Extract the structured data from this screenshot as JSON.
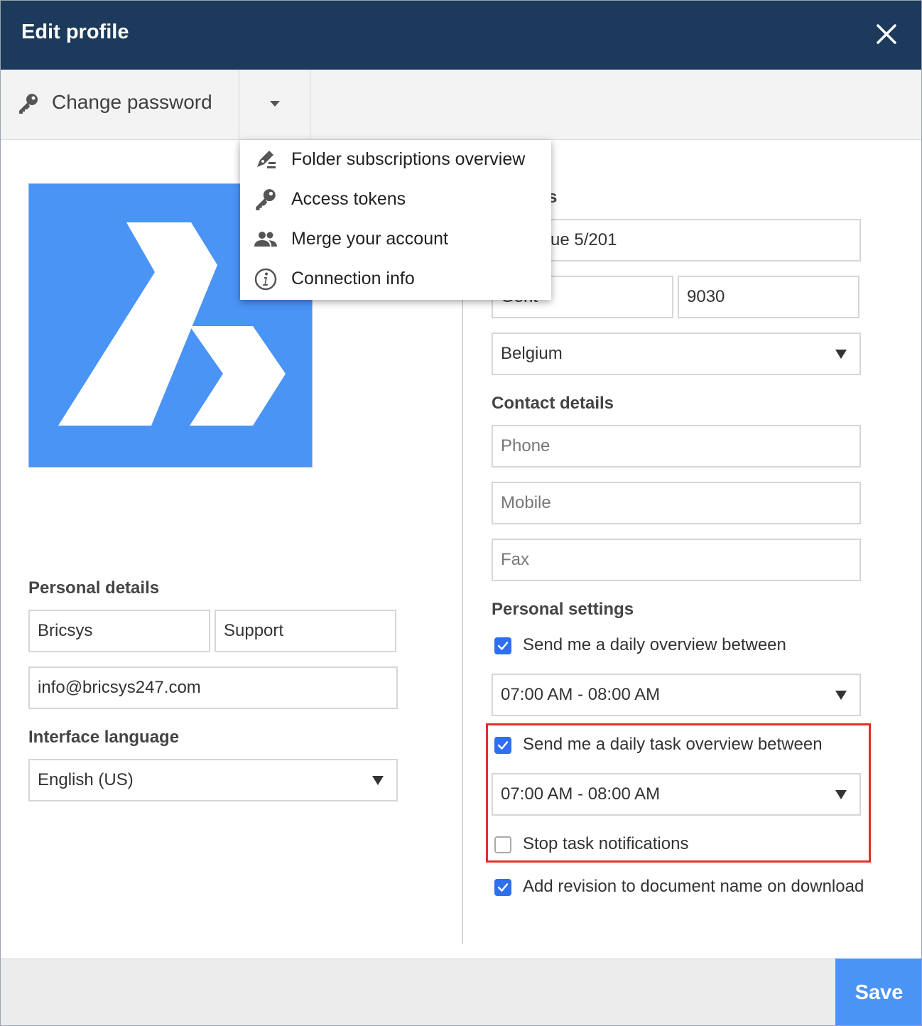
{
  "dialog": {
    "title": "Edit profile"
  },
  "toolbar": {
    "change_password_label": "Change password"
  },
  "menu": {
    "items": [
      {
        "label": "Folder subscriptions overview",
        "icon": "pen-sign-icon"
      },
      {
        "label": "Access tokens",
        "icon": "key-icon"
      },
      {
        "label": "Merge your account",
        "icon": "people-icon"
      },
      {
        "label": "Connection info",
        "icon": "info-icon"
      }
    ]
  },
  "avatar": {
    "color": "#4a94f6",
    "icon": "bricsys-logo"
  },
  "address": {
    "heading_partial": "s",
    "street": "ue 5/201",
    "city_partial": "Gent",
    "zip": "9030",
    "country": "Belgium"
  },
  "contact": {
    "heading": "Contact details",
    "phone_placeholder": "Phone",
    "mobile_placeholder": "Mobile",
    "fax_placeholder": "Fax"
  },
  "personal": {
    "heading": "Personal details",
    "first_name": "Bricsys",
    "last_name": "Support",
    "email": "info@bricsys247.com"
  },
  "language": {
    "heading": "Interface language",
    "value": "English (US)"
  },
  "settings": {
    "heading": "Personal settings",
    "daily_overview_label": "Send me a daily overview between",
    "daily_overview_checked": true,
    "daily_overview_time": "07:00 AM - 08:00 AM",
    "task_overview_label": "Send me a daily task overview between",
    "task_overview_checked": true,
    "task_overview_time": "07:00 AM - 08:00 AM",
    "stop_notifications_label": "Stop task notifications",
    "stop_notifications_checked": false,
    "add_revision_label": "Add revision to document name on download",
    "add_revision_checked": true
  },
  "footer": {
    "save_label": "Save"
  },
  "colors": {
    "header_bg": "#1b3a5c",
    "accent": "#4a94f6",
    "checkbox": "#2d6ff0",
    "highlight": "#e03128"
  }
}
